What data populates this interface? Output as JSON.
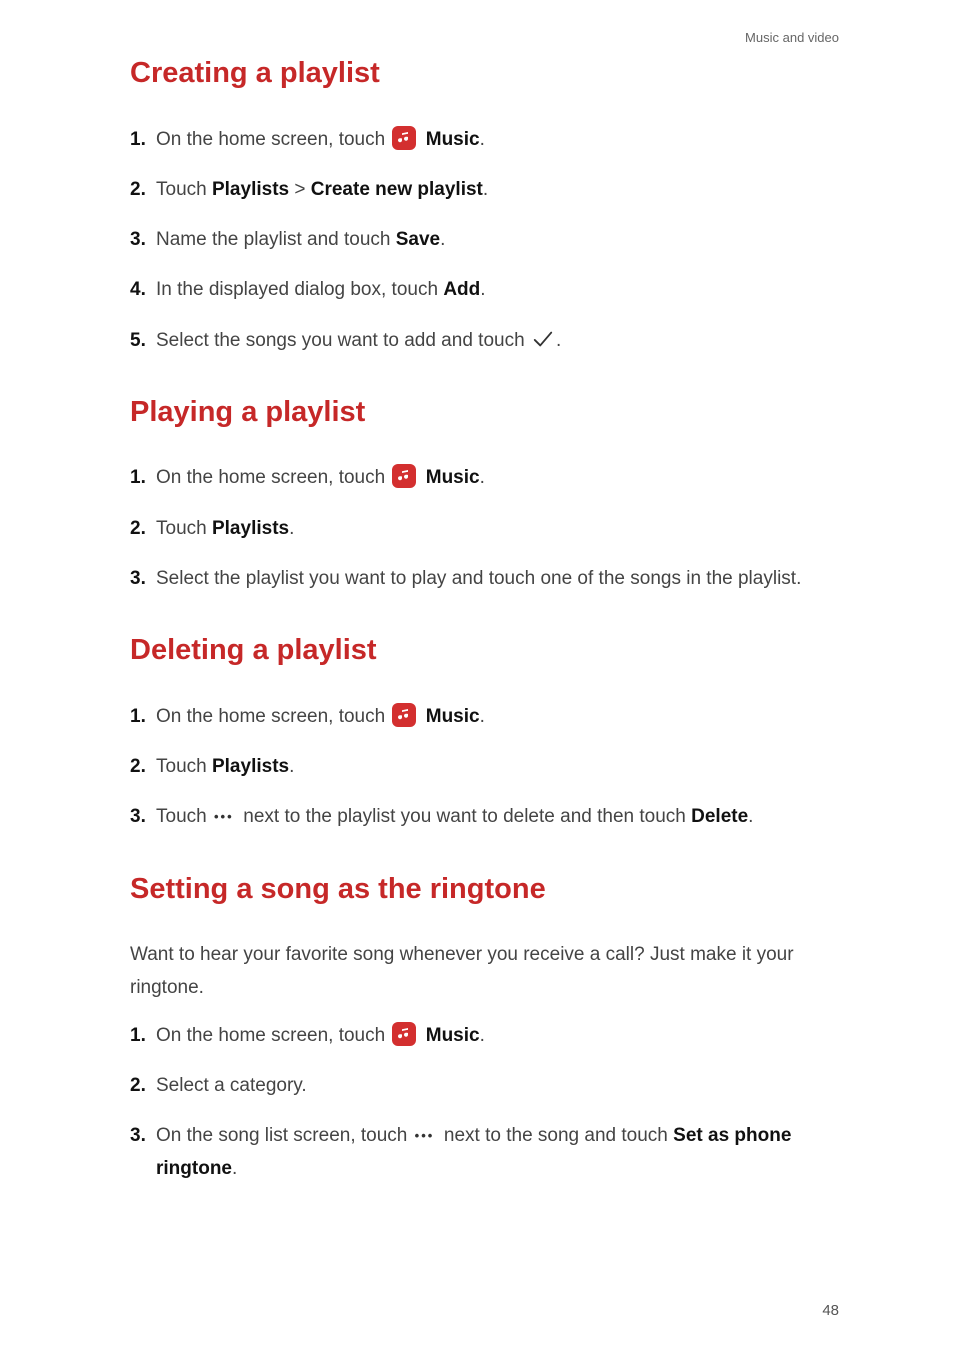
{
  "header": "Music and video",
  "page_number": "48",
  "app_name": "Music",
  "sections": [
    {
      "title": "Creating a playlist",
      "intro": null,
      "steps": [
        {
          "prefix": "On the home screen, touch ",
          "icon": "music",
          "bold_after_icon": "Music",
          "suffix": "."
        },
        {
          "parts": [
            "Touch ",
            {
              "b": "Playlists"
            },
            " > ",
            {
              "b": "Create new playlist"
            },
            "."
          ]
        },
        {
          "parts": [
            "Name the playlist and touch ",
            {
              "b": "Save"
            },
            "."
          ]
        },
        {
          "parts": [
            "In the displayed dialog box, touch ",
            {
              "b": "Add"
            },
            "."
          ]
        },
        {
          "parts": [
            "Select the songs you want to add and touch ",
            {
              "icon": "check"
            },
            "."
          ]
        }
      ]
    },
    {
      "title": "Playing a playlist",
      "intro": null,
      "steps": [
        {
          "prefix": "On the home screen, touch ",
          "icon": "music",
          "bold_after_icon": "Music",
          "suffix": "."
        },
        {
          "parts": [
            "Touch ",
            {
              "b": "Playlists"
            },
            "."
          ]
        },
        {
          "parts": [
            "Select the playlist you want to play and touch one of the songs in the playlist."
          ]
        }
      ]
    },
    {
      "title": "Deleting a playlist",
      "intro": null,
      "steps": [
        {
          "prefix": "On the home screen, touch ",
          "icon": "music",
          "bold_after_icon": "Music",
          "suffix": "."
        },
        {
          "parts": [
            "Touch ",
            {
              "b": "Playlists"
            },
            "."
          ]
        },
        {
          "parts": [
            "Touch ",
            {
              "icon": "dots"
            },
            " next to the playlist you want to delete and then touch ",
            {
              "b": "Delete"
            },
            "."
          ]
        }
      ]
    },
    {
      "title": "Setting a song as the ringtone",
      "intro": "Want to hear your favorite song whenever you receive a call? Just make it your ringtone.",
      "steps": [
        {
          "prefix": "On the home screen, touch ",
          "icon": "music",
          "bold_after_icon": "Music",
          "suffix": "."
        },
        {
          "parts": [
            "Select a category."
          ]
        },
        {
          "parts": [
            "On the song list screen, touch ",
            {
              "icon": "dots"
            },
            " next to the song and touch ",
            {
              "b": "Set as phone ringtone"
            },
            "."
          ]
        }
      ]
    }
  ]
}
